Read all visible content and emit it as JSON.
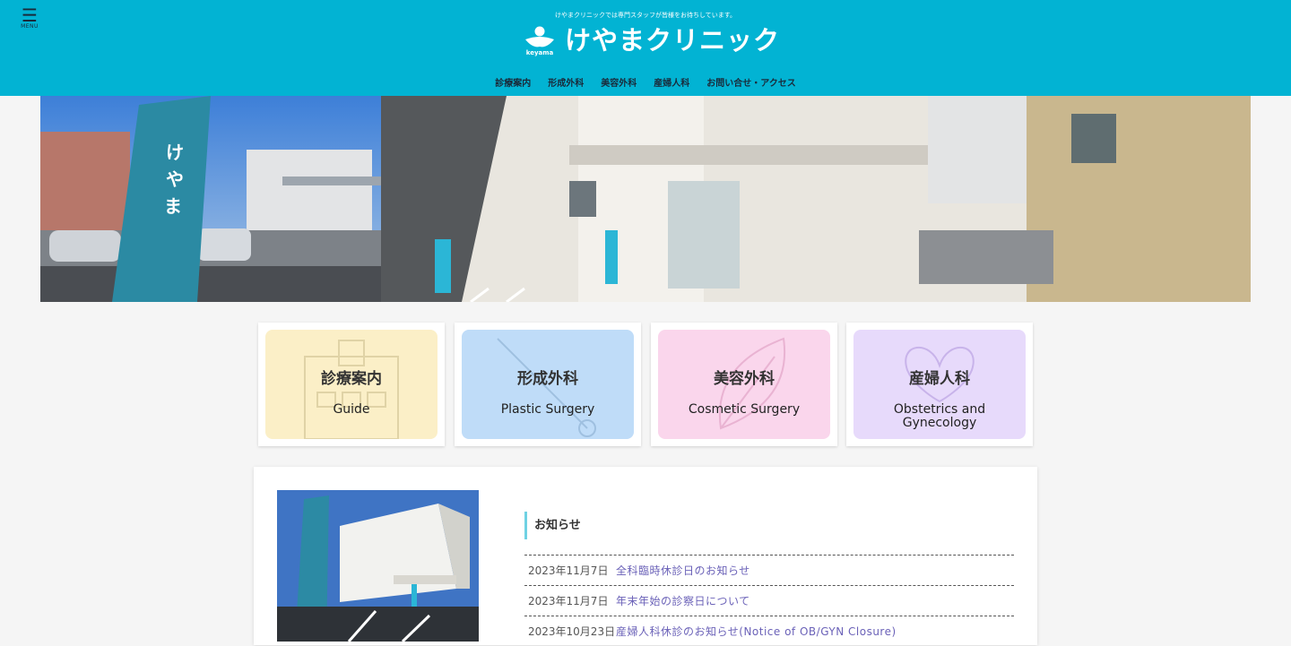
{
  "header": {
    "menu_icon": "hamburger-icon",
    "menu_label": "MENU",
    "tagline": "けやまクリニックでは専門スタッフが皆様をお待ちしています。",
    "logo_text": "けやまクリニック",
    "logo_sub": "keyama",
    "brand_color": "#02b3d3"
  },
  "nav": {
    "items": [
      "診療案内",
      "形成外科",
      "美容外科",
      "産婦人科",
      "お問い合せ・アクセス"
    ]
  },
  "cards": [
    {
      "ja": "診療案内",
      "en": "Guide",
      "bg": "#fbefc7",
      "icon": "hospital-building-icon"
    },
    {
      "ja": "形成外科",
      "en": "Plastic Surgery",
      "bg": "#bfdcf8",
      "icon": "scalpel-icon"
    },
    {
      "ja": "美容外科",
      "en": "Cosmetic Surgery",
      "bg": "#fad6ec",
      "icon": "leaf-icon"
    },
    {
      "ja": "産婦人科",
      "en_line1": "Obstetrics and",
      "en_line2": "Gynecology",
      "bg": "#e7dafb",
      "icon": "heart-icon"
    }
  ],
  "news": {
    "heading": "お知らせ",
    "items": [
      {
        "date": "2023年11月7日",
        "title": "全科臨時休診日のお知らせ"
      },
      {
        "date": "2023年11月7日",
        "title": "年末年始の診察日について"
      },
      {
        "date": "2023年10月23日",
        "title": "産婦人科休診のお知らせ(Notice of OB/GYN Closure)"
      }
    ]
  }
}
